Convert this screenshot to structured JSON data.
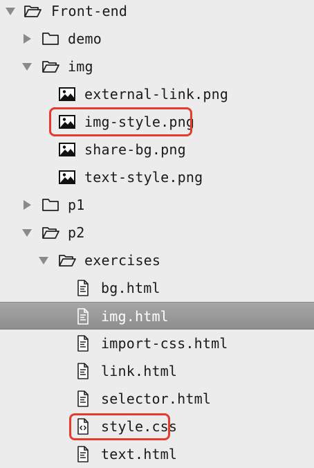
{
  "tree": {
    "root": "Front-end",
    "demo": "demo",
    "img": "img",
    "external_link": "external-link.png",
    "img_style": "img-style.png",
    "share_bg": "share-bg.png",
    "text_style": "text-style.png",
    "p1": "p1",
    "p2": "p2",
    "exercises": "exercises",
    "bg_html": "bg.html",
    "img_html": "img.html",
    "import_css": "import-css.html",
    "link_html": "link.html",
    "selector_html": "selector.html",
    "style_css": "style.css",
    "text_html": "text.html"
  },
  "state": {
    "selected": "img.html",
    "highlighted": [
      "img-style.png",
      "style.css"
    ]
  },
  "colors": {
    "background": "#ececec",
    "selection": "#8e8e8e",
    "highlight": "#e53a2f"
  }
}
